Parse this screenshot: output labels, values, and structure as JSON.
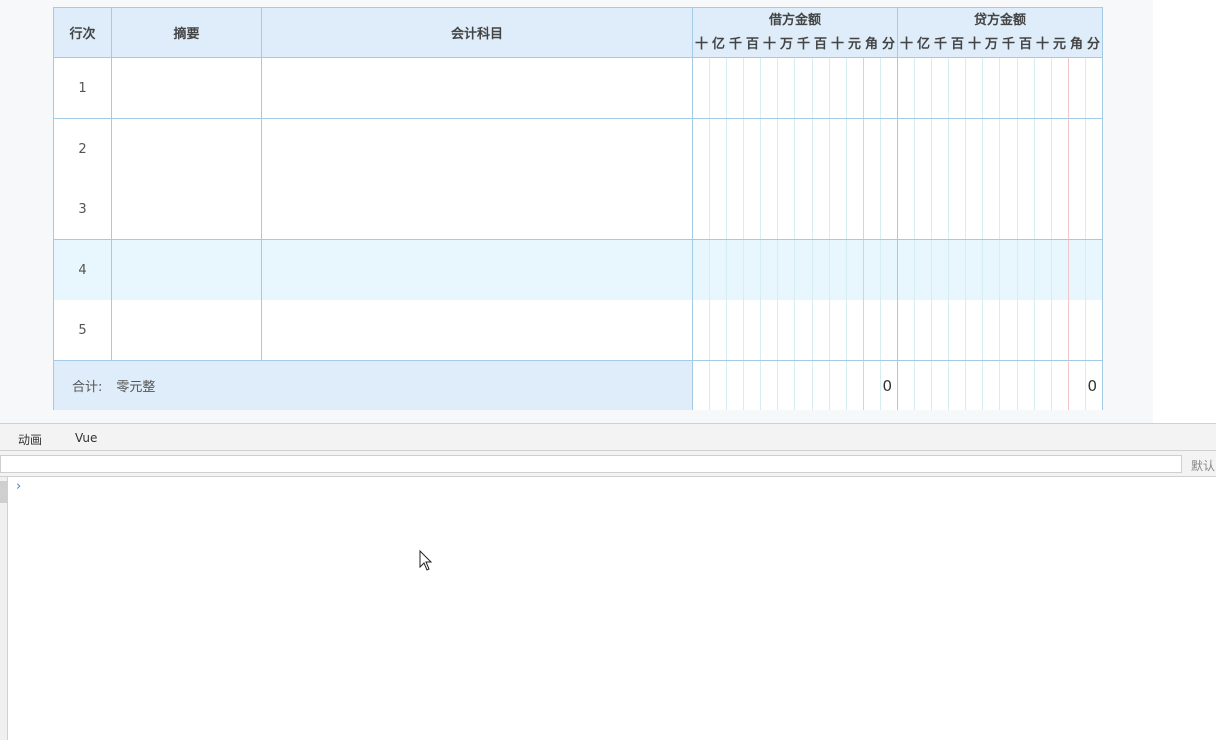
{
  "voucher": {
    "headers": {
      "row_no": "行次",
      "summary": "摘要",
      "account": "会计科目",
      "debit": "借方金额",
      "credit": "贷方金额"
    },
    "digit_units": [
      "十",
      "亿",
      "千",
      "百",
      "十",
      "万",
      "千",
      "百",
      "十",
      "元",
      "角",
      "分"
    ],
    "rows": [
      {
        "no": "1"
      },
      {
        "no": "2"
      },
      {
        "no": "3"
      },
      {
        "no": "4"
      },
      {
        "no": "5"
      }
    ],
    "highlighted_row": "4",
    "total": {
      "label": "合计:",
      "amount_words": "零元整",
      "debit_total": "0",
      "credit_total": "0"
    }
  },
  "devtools": {
    "tabs": [
      "动画",
      "Vue"
    ],
    "filter": {
      "value": "",
      "level_label": "默认"
    },
    "console_prompt": "›"
  },
  "colors": {
    "border": "#a3cbe6",
    "header_bg": "#deedf9",
    "highlight_row_bg": "#e8f7fd",
    "yuan_line": "#f3c6c9",
    "digit_line": "#d6eef2"
  }
}
